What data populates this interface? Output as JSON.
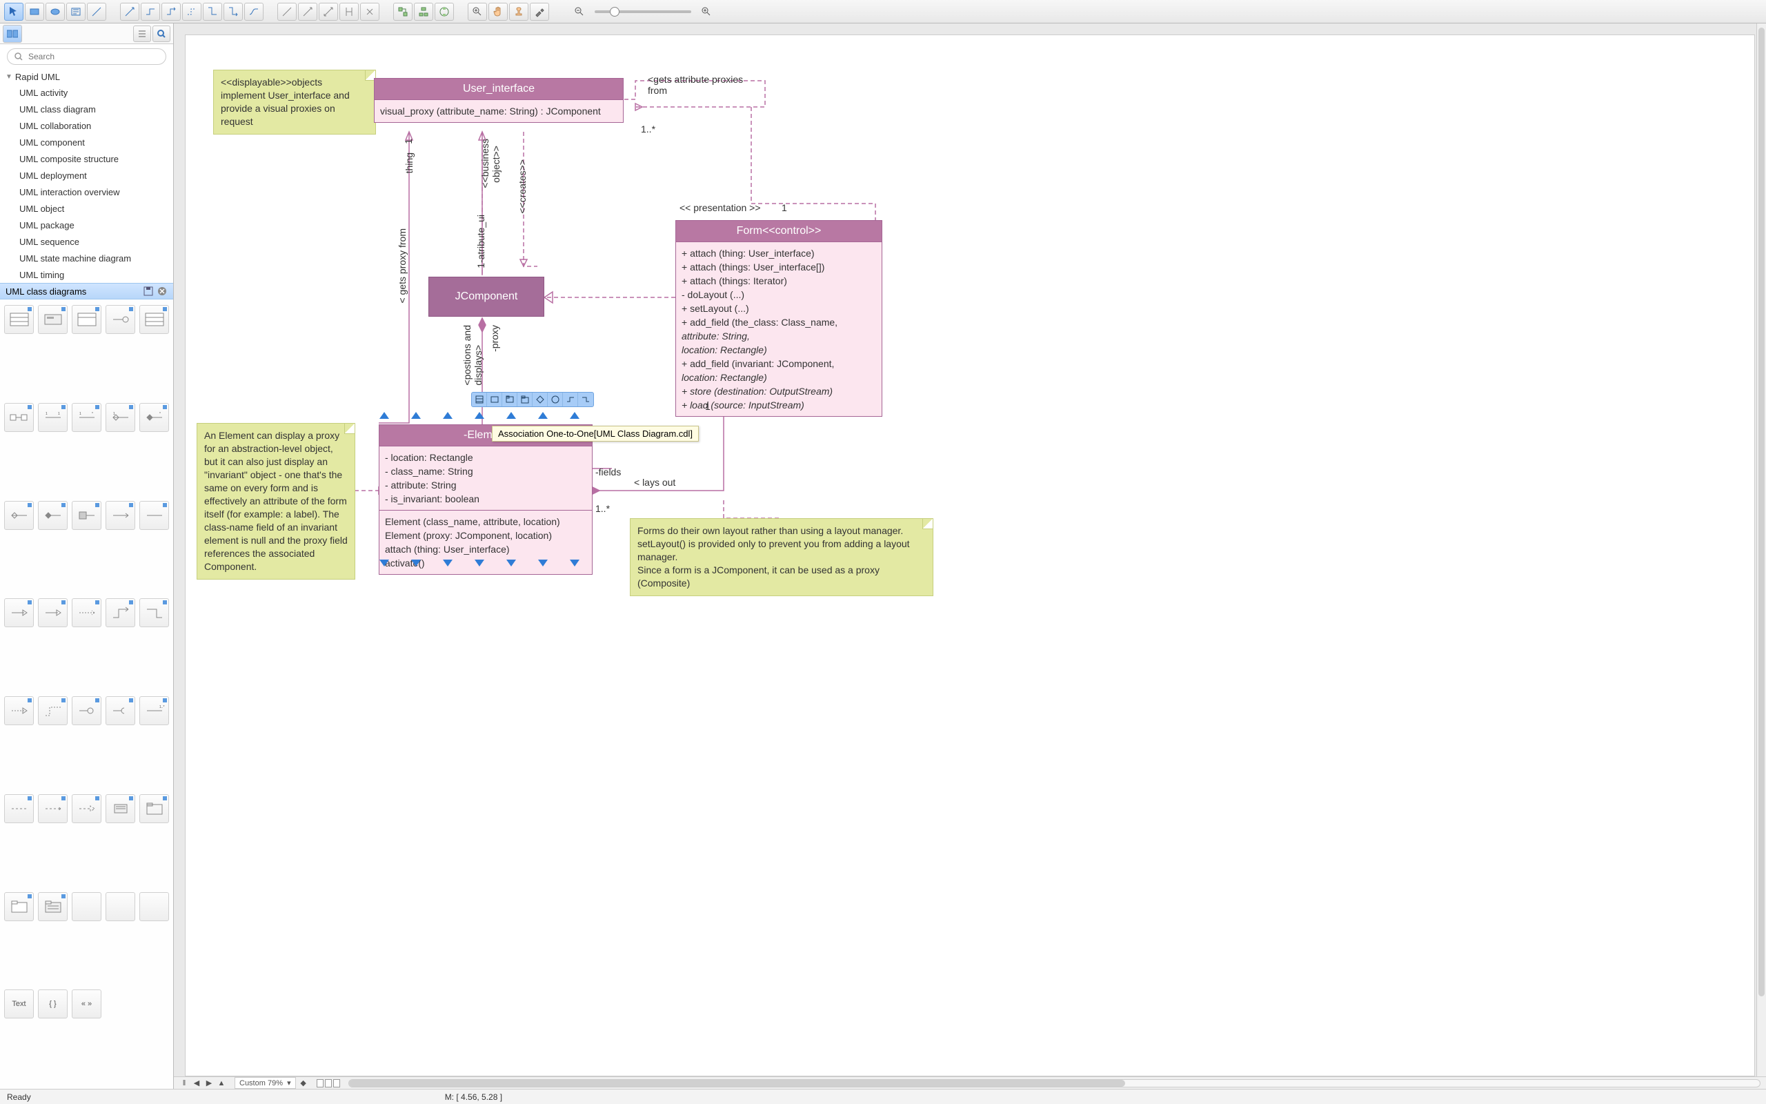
{
  "search": {
    "placeholder": "Search"
  },
  "tree": {
    "root": "Rapid UML",
    "items": [
      "UML activity",
      "UML class diagram",
      "UML collaboration",
      "UML component",
      "UML composite structure",
      "UML deployment",
      "UML interaction overview",
      "UML object",
      "UML package",
      "UML sequence",
      "UML state machine diagram",
      "UML timing"
    ]
  },
  "library": {
    "title": "UML class diagrams",
    "text_tool": "Text",
    "bracket_tool": "{ }",
    "arrows_tool": "« »"
  },
  "diagram": {
    "user_interface": {
      "title": "User_interface",
      "method": "visual_proxy (attribute_name: String) : JComponent"
    },
    "jcomponent": "JComponent",
    "form": {
      "title": "Form<<control>>",
      "methods": [
        "+ attach (thing: User_interface)",
        "+ attach (things: User_interface[])",
        "+ attach (things: Iterator)",
        "- doLayout (...)",
        "+ setLayout (...)",
        "+ add_field (the_class: Class_name,",
        "                    attribute: String,",
        "                    location: Rectangle)",
        "+ add_field (invariant: JComponent,",
        "                    location: Rectangle)",
        "+ store (destination: OutputStream)",
        "+ load (source: InputStream)"
      ]
    },
    "element": {
      "title": "-Element",
      "attrs": [
        "- location: Rectangle",
        "- class_name: String",
        "- attribute: String",
        "- is_invariant: boolean"
      ],
      "methods": [
        "Element (class_name, attribute, location)",
        "Element (proxy: JComponent, location)",
        "attach (thing: User_interface)",
        "activate()"
      ]
    },
    "note_displayable": "<<displayable>>objects implement User_interface and provide a visual proxies on request",
    "note_element": "An Element can display a proxy for an abstraction-level object, but it can also just display an \"invariant\" object - one that's the same on every form and is effectively an attribute of the form itself (for example: a label). The class-name field of an invariant element is null and the proxy field references the associated Component.",
    "note_form": "Forms do their own layout rather than using a layout manager. setLayout() is provided only to prevent you from adding a layout manager.\nSince a form is a JComponent, it can be used as a proxy (Composite)",
    "labels": {
      "gets_proxy_from": "< gets proxy from",
      "thing": "thing",
      "one_top": "1",
      "business_object": "<<business\n  object>>",
      "atribute_ui": "-atribute_ui",
      "creates": "<<creates>>",
      "one_mid": "1",
      "proxy": "-proxy",
      "gets_attr_proxies": "<gets attribute proxies\nfrom",
      "one_star": "1..*",
      "presentation": "<< presentation >>",
      "one_right": "1",
      "one_form_bottom": "1",
      "lays_out": "< lays out",
      "one_star2": "1..*",
      "fields": "-fields",
      "positions_and_displays": "<postions and\ndisplays>"
    },
    "tooltip": "Association One-to-One[UML Class Diagram.cdl]"
  },
  "bottom": {
    "zoom": "Custom 79%"
  },
  "status": {
    "ready": "Ready",
    "coords": "M: [ 4.56, 5.28 ]"
  }
}
